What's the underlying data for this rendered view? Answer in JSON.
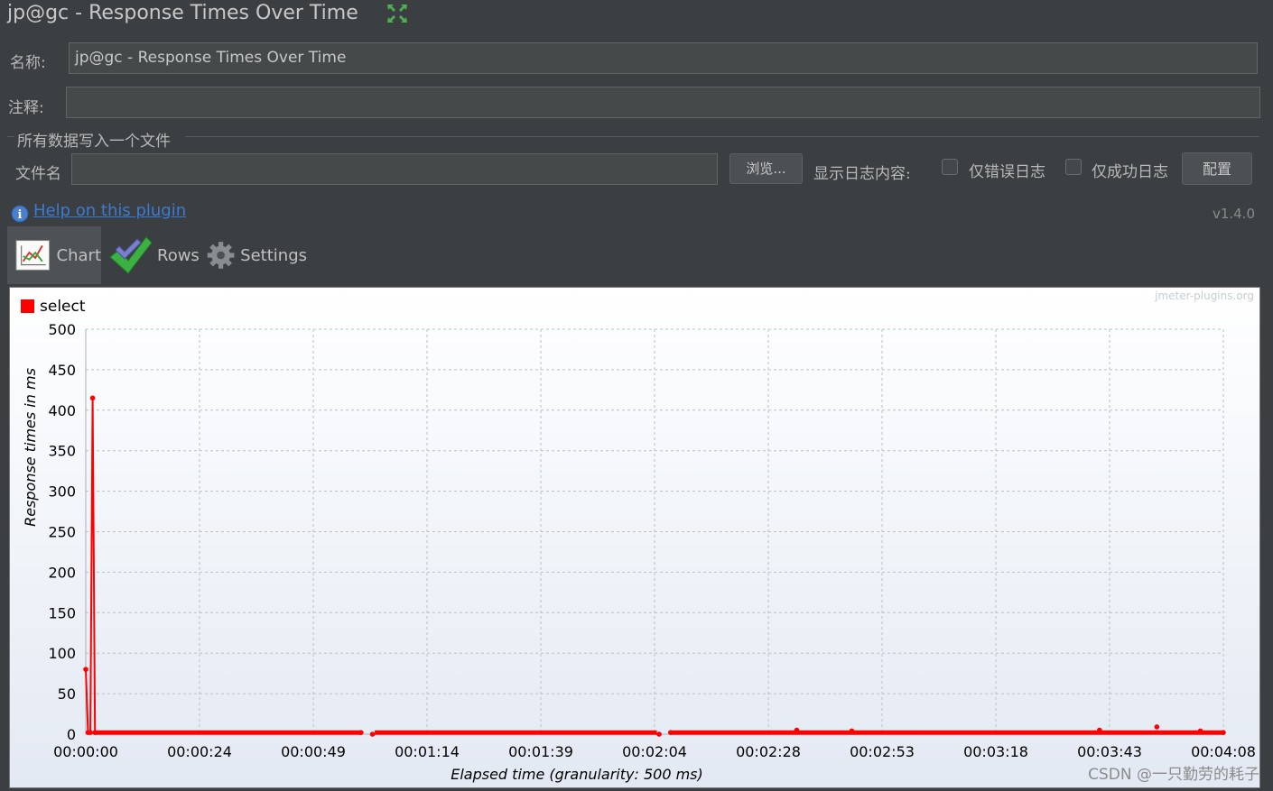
{
  "window": {
    "title": "jp@gc - Response Times Over Time"
  },
  "form": {
    "name_label": "名称:",
    "name_value": "jp@gc - Response Times Over Time",
    "comment_label": "注释:",
    "comment_value": "",
    "group_title": "所有数据写入一个文件",
    "filename_label": "文件名",
    "filename_value": "",
    "browse_label": "浏览...",
    "log_content_label": "显示日志内容:",
    "errors_only_label": "仅错误日志",
    "errors_only_checked": false,
    "success_only_label": "仅成功日志",
    "success_only_checked": false,
    "configure_label": "配置"
  },
  "help": {
    "link_text": "Help on this plugin",
    "version": "v1.4.0"
  },
  "tabs": [
    {
      "label": "Chart",
      "icon": "chart-icon",
      "active": true
    },
    {
      "label": "Rows",
      "icon": "checkmark-icon",
      "active": false
    },
    {
      "label": "Settings",
      "icon": "gear-icon",
      "active": false
    }
  ],
  "watermark": "jmeter-plugins.org",
  "csdn_watermark": "CSDN @一只勤劳的耗子",
  "colors": {
    "series": "#ff0000",
    "background": "#3c3f41",
    "link": "#3a7bd5"
  },
  "chart_data": {
    "type": "line",
    "ylabel": "Response times in ms",
    "xlabel": "Elapsed time (granularity: 500 ms)",
    "ylim": [
      0,
      500
    ],
    "yticks": [
      "0",
      "50",
      "100",
      "150",
      "200",
      "250",
      "300",
      "350",
      "400",
      "450",
      "500"
    ],
    "xticks": [
      "00:00:00",
      "00:00:24",
      "00:00:49",
      "00:01:14",
      "00:01:39",
      "00:02:04",
      "00:02:28",
      "00:02:53",
      "00:03:18",
      "00:03:43",
      "00:04:08"
    ],
    "xlim_seconds": [
      0,
      248
    ],
    "grid": true,
    "legend_position": "top-left",
    "series": [
      {
        "name": "select",
        "points": [
          {
            "t": 0.0,
            "y": 80
          },
          {
            "t": 0.5,
            "y": 2
          },
          {
            "t": 1.0,
            "y": 2
          },
          {
            "t": 1.5,
            "y": 415
          },
          {
            "t": 2.0,
            "y": 2
          },
          {
            "t": 60.0,
            "y": 2
          },
          {
            "t": 62.5,
            "y": 0
          },
          {
            "t": 125.0,
            "y": 0
          },
          {
            "t": 127.5,
            "y": 2
          },
          {
            "t": 155.0,
            "y": 5
          },
          {
            "t": 167.0,
            "y": 4
          },
          {
            "t": 221.0,
            "y": 5
          },
          {
            "t": 233.5,
            "y": 9
          },
          {
            "t": 243.0,
            "y": 4
          },
          {
            "t": 248.0,
            "y": 2
          }
        ],
        "segments": [
          [
            2.0,
            60.0
          ],
          [
            63.0,
            124.5
          ],
          [
            127.5,
            248.0
          ]
        ]
      }
    ]
  }
}
